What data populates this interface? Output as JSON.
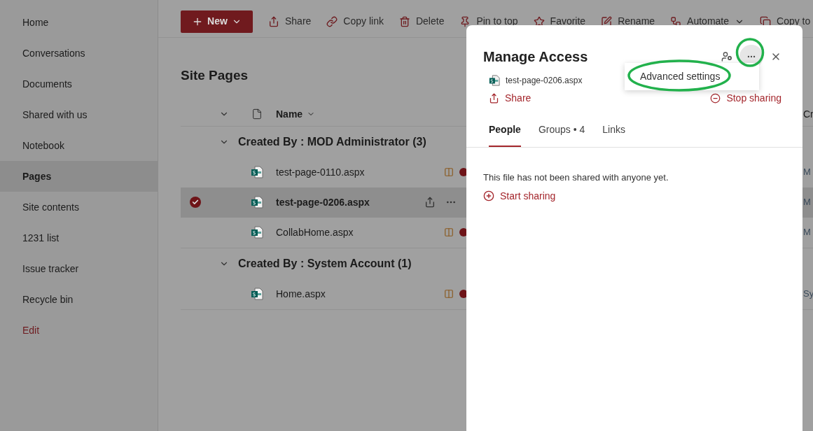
{
  "sidebar": {
    "items": [
      {
        "label": "Home",
        "selected": false,
        "kind": "nav"
      },
      {
        "label": "Conversations",
        "selected": false,
        "kind": "nav"
      },
      {
        "label": "Documents",
        "selected": false,
        "kind": "nav"
      },
      {
        "label": "Shared with us",
        "selected": false,
        "kind": "nav"
      },
      {
        "label": "Notebook",
        "selected": false,
        "kind": "nav"
      },
      {
        "label": "Pages",
        "selected": true,
        "kind": "nav"
      },
      {
        "label": "Site contents",
        "selected": false,
        "kind": "nav"
      },
      {
        "label": "1231 list",
        "selected": false,
        "kind": "nav"
      },
      {
        "label": "Issue tracker",
        "selected": false,
        "kind": "nav"
      },
      {
        "label": "Recycle bin",
        "selected": false,
        "kind": "nav"
      },
      {
        "label": "Edit",
        "selected": false,
        "kind": "edit"
      }
    ]
  },
  "toolbar": {
    "new_button": "New",
    "items": [
      {
        "label": "Share",
        "kind": "share"
      },
      {
        "label": "Copy link",
        "kind": "link"
      },
      {
        "label": "Delete",
        "kind": "delete"
      },
      {
        "label": "Pin to top",
        "kind": "pin"
      },
      {
        "label": "Favorite",
        "kind": "favorite"
      },
      {
        "label": "Rename",
        "kind": "rename"
      },
      {
        "label": "Automate",
        "kind": "automate"
      },
      {
        "label": "Copy to",
        "kind": "copy"
      }
    ]
  },
  "library": {
    "title": "Site Pages",
    "columns": [
      {
        "label": "Name"
      },
      {
        "label": "Cr"
      }
    ],
    "groups": [
      {
        "label": "Created By : MOD Administrator (3)",
        "expanded": true,
        "rows": [
          {
            "name": "test-page-0110.aspx",
            "selected": false,
            "column_3": "M"
          },
          {
            "name": "test-page-0206.aspx",
            "selected": true,
            "column_3": "M"
          },
          {
            "name": "CollabHome.aspx",
            "selected": false,
            "column_3": "M"
          }
        ]
      },
      {
        "label": "Created By : System Account (1)",
        "expanded": true,
        "rows": [
          {
            "name": "Home.aspx",
            "selected": false,
            "column_3": "Sy"
          }
        ]
      }
    ]
  },
  "panel": {
    "title": "Manage Access",
    "file": "test-page-0206.aspx",
    "share": "Share",
    "stop_sharing": "Stop sharing",
    "menu": [
      {
        "label": "Advanced settings"
      }
    ],
    "tabs": [
      {
        "label": "People",
        "selected": true
      },
      {
        "label": "Groups • 4",
        "selected": false
      },
      {
        "label": "Links",
        "selected": false
      }
    ],
    "message": "This file has not been shared with anyone yet.",
    "start_sharing": "Start sharing"
  }
}
